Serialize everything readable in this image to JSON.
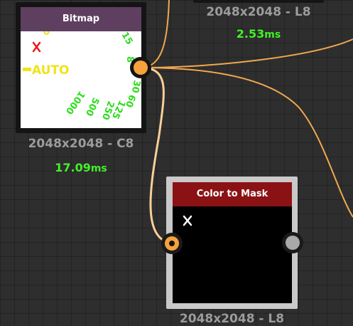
{
  "top_node": {
    "resolution": "2048x2048 - L8",
    "time": "2.53",
    "time_unit": "ms"
  },
  "bitmap_node": {
    "title": "Bitmap",
    "resolution": "2048x2048 - C8",
    "time": "17.09",
    "time_unit": "ms",
    "thumbnail": {
      "auto_label": "AUTO",
      "dial_labels": [
        "8",
        "15",
        "30",
        "60",
        "125",
        "250",
        "500",
        "1000"
      ]
    }
  },
  "color_to_mask_node": {
    "title": "Color to Mask",
    "resolution": "2048x2048 - L8"
  },
  "colors": {
    "bitmap_header": "#5f3f60",
    "color_to_mask_header": "#8b1214",
    "wire": "#f5b56a",
    "port_orange": "#f6a23c",
    "port_grey": "#a9a9a9",
    "timing_green": "#44f02a",
    "dial_green": "#2fdc1e",
    "auto_yellow": "#f2e21a",
    "cross_red": "#e81a1a"
  }
}
